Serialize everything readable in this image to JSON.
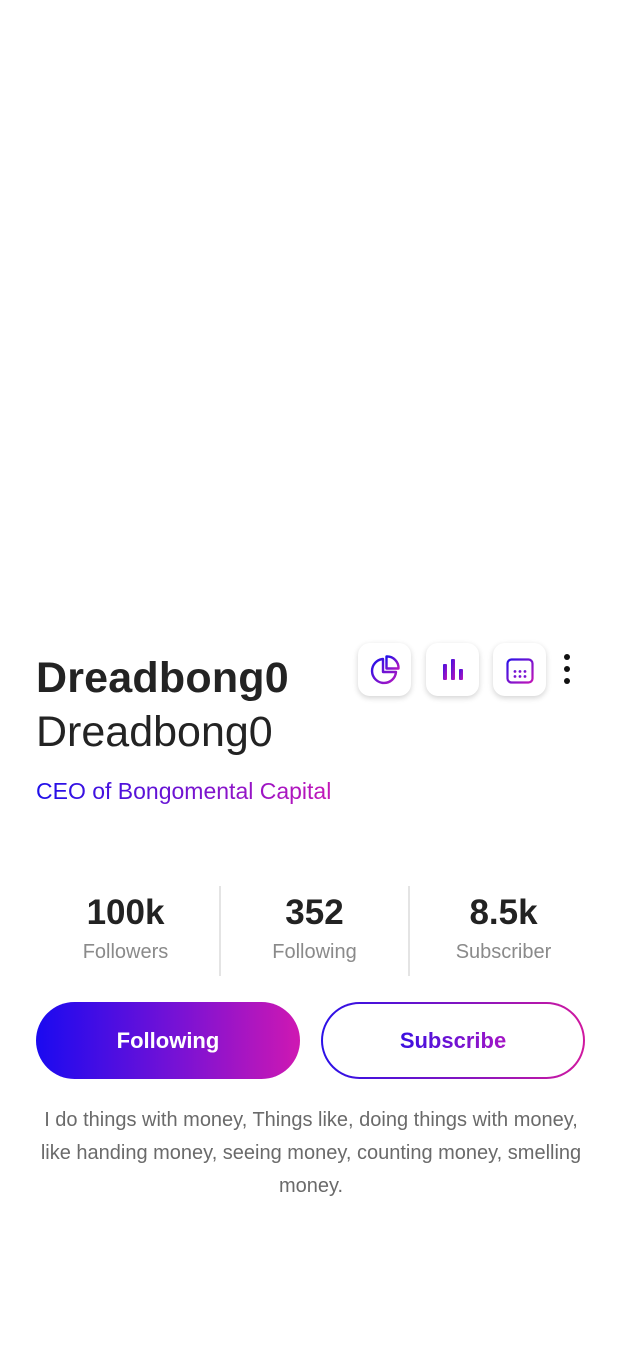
{
  "profile": {
    "display_name": "Dreadbong0",
    "username": "Dreadbong0",
    "title": "CEO of Bongomental Capital",
    "bio": "I do things with money, Things like, doing things with money, like handing money, seeing money, counting money, smelling money."
  },
  "toolbar": {
    "icons": [
      "pie-chart-icon",
      "bar-chart-icon",
      "calendar-icon",
      "more-vertical-icon"
    ]
  },
  "stats": [
    {
      "value": "100k",
      "label": "Followers"
    },
    {
      "value": "352",
      "label": "Following"
    },
    {
      "value": "8.5k",
      "label": "Subscriber"
    }
  ],
  "actions": {
    "following_label": "Following",
    "subscribe_label": "Subscribe"
  },
  "colors": {
    "gradient_start": "#1a0af0",
    "gradient_end": "#cf18b2",
    "text_dark": "#232323",
    "text_muted": "#8a8a8a"
  }
}
